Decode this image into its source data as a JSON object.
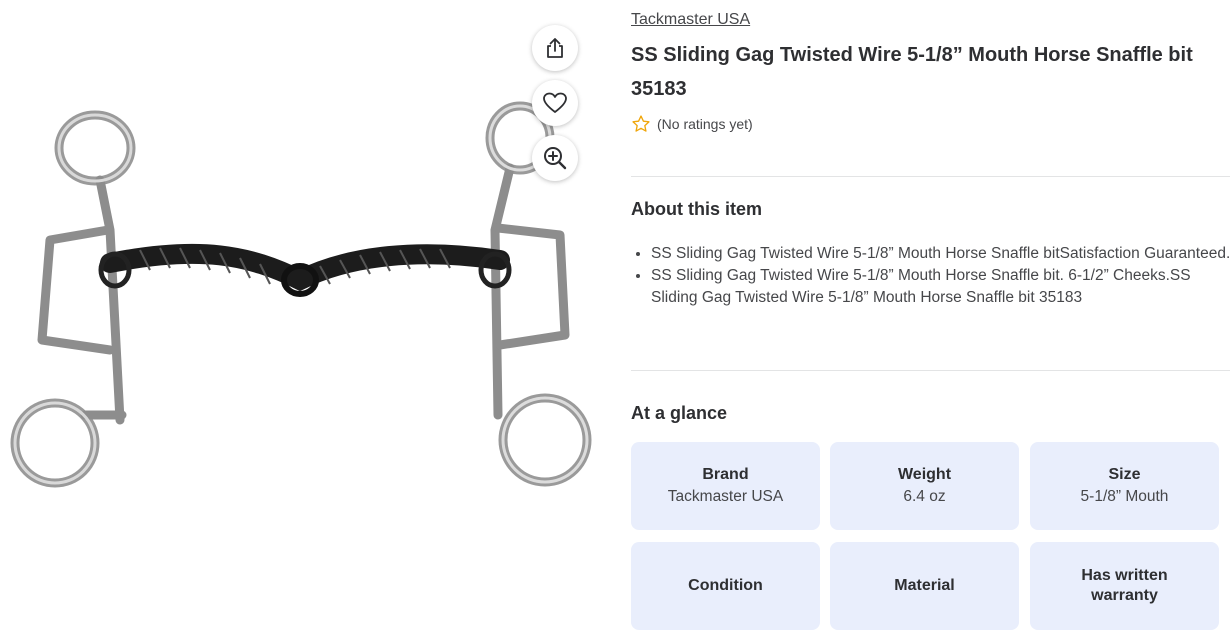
{
  "product": {
    "brand": "Tackmaster USA",
    "title": "SS Sliding Gag Twisted Wire 5-1/8” Mouth Horse Snaffle bit 35183",
    "rating_text": "(No ratings yet)"
  },
  "actions": {
    "share_icon": "share-icon",
    "favorite_icon": "heart-icon",
    "zoom_icon": "zoom-in-icon"
  },
  "about": {
    "heading": "About this item",
    "bullets": [
      "SS Sliding Gag Twisted Wire 5-1/8” Mouth Horse Snaffle bitSatisfaction Guaranteed.",
      "SS Sliding Gag Twisted Wire 5-1/8” Mouth Horse Snaffle bit. 6-1/2” Cheeks.SS Sliding Gag Twisted Wire 5-1/8” Mouth Horse Snaffle bit 35183"
    ]
  },
  "glance": {
    "heading": "At a glance",
    "tiles": [
      {
        "label": "Brand",
        "value": "Tackmaster USA"
      },
      {
        "label": "Weight",
        "value": "6.4 oz"
      },
      {
        "label": "Size",
        "value": "5-1/8” Mouth"
      },
      {
        "label": "Condition",
        "value": ""
      },
      {
        "label": "Material",
        "value": ""
      },
      {
        "label": "Has written warranty",
        "value": ""
      }
    ]
  },
  "colors": {
    "star": "#f0a60b",
    "tile_bg": "#e9eefc",
    "text_primary": "#2e2f32"
  }
}
